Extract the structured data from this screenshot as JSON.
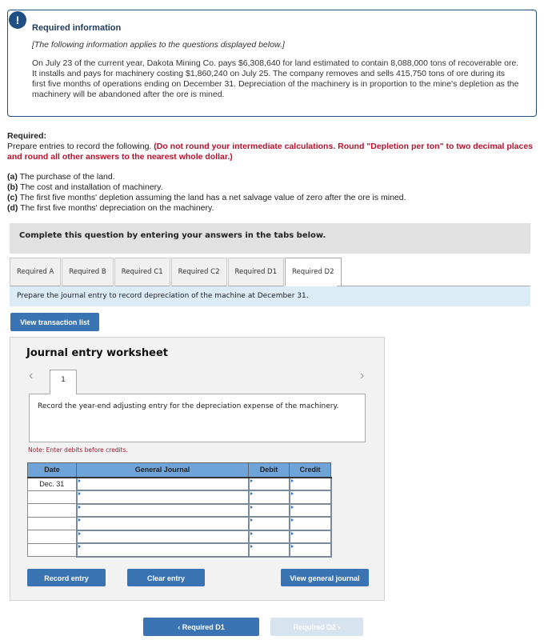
{
  "info": {
    "badge": "!",
    "title": "Required information",
    "intro": "[The following information applies to the questions displayed below.]",
    "body": "On July 23 of the current year, Dakota Mining Co. pays $6,308,640 for land estimated to contain 8,088,000 tons of recoverable ore. It installs and pays for machinery costing $1,860,240 on July 25. The company removes and sells 415,750 tons of ore during its first five months of operations ending on December 31. Depreciation of the machinery is in proportion to the mine's depletion as the machinery will be abandoned after the ore is mined."
  },
  "required": {
    "heading": "Required:",
    "lead": "Prepare entries to record the following. ",
    "note": "(Do not round your intermediate calculations. Round \"Depletion per ton\" to two decimal places and round all other answers to the nearest whole dollar.)",
    "items": [
      {
        "key": "(a)",
        "text": " The purchase of the land."
      },
      {
        "key": "(b)",
        "text": " The cost and installation of machinery."
      },
      {
        "key": "(c)",
        "text": " The first five months' depletion assuming the land has a net salvage value of zero after the ore is mined."
      },
      {
        "key": "(d)",
        "text": " The first five months' depreciation on the machinery."
      }
    ]
  },
  "complete_bar": "Complete this question by entering your answers in the tabs below.",
  "tabs": [
    {
      "label": "Required A"
    },
    {
      "label": "Required B"
    },
    {
      "label": "Required C1"
    },
    {
      "label": "Required C2"
    },
    {
      "label": "Required D1"
    },
    {
      "label": "Required D2",
      "active": true
    }
  ],
  "instruction": "Prepare the journal entry to record depreciation of the machine at December 31.",
  "view_transaction_list": "View transaction list",
  "worksheet": {
    "title": "Journal entry worksheet",
    "prev_icon": "‹",
    "next_icon": "›",
    "entry_number": "1",
    "description": "Record the year-end adjusting entry for the depreciation expense of the machinery.",
    "note": "Note: Enter debits before credits.",
    "columns": [
      "Date",
      "General Journal",
      "Debit",
      "Credit"
    ],
    "rows": [
      {
        "date": "Dec. 31",
        "account": "",
        "debit": "",
        "credit": ""
      },
      {
        "date": "",
        "account": "",
        "debit": "",
        "credit": ""
      },
      {
        "date": "",
        "account": "",
        "debit": "",
        "credit": ""
      },
      {
        "date": "",
        "account": "",
        "debit": "",
        "credit": ""
      },
      {
        "date": "",
        "account": "",
        "debit": "",
        "credit": ""
      },
      {
        "date": "",
        "account": "",
        "debit": "",
        "credit": ""
      }
    ],
    "record_entry": "Record entry",
    "clear_entry": "Clear entry",
    "view_general_journal": "View general journal"
  },
  "nav": {
    "prev_label": "‹   Required D1",
    "next_label": "Required D2   ›"
  },
  "colors": {
    "accent": "#3a74b3",
    "header_blue": "#6fa4d9",
    "warning_red": "#b8122b",
    "info_border": "#1f4f85"
  }
}
